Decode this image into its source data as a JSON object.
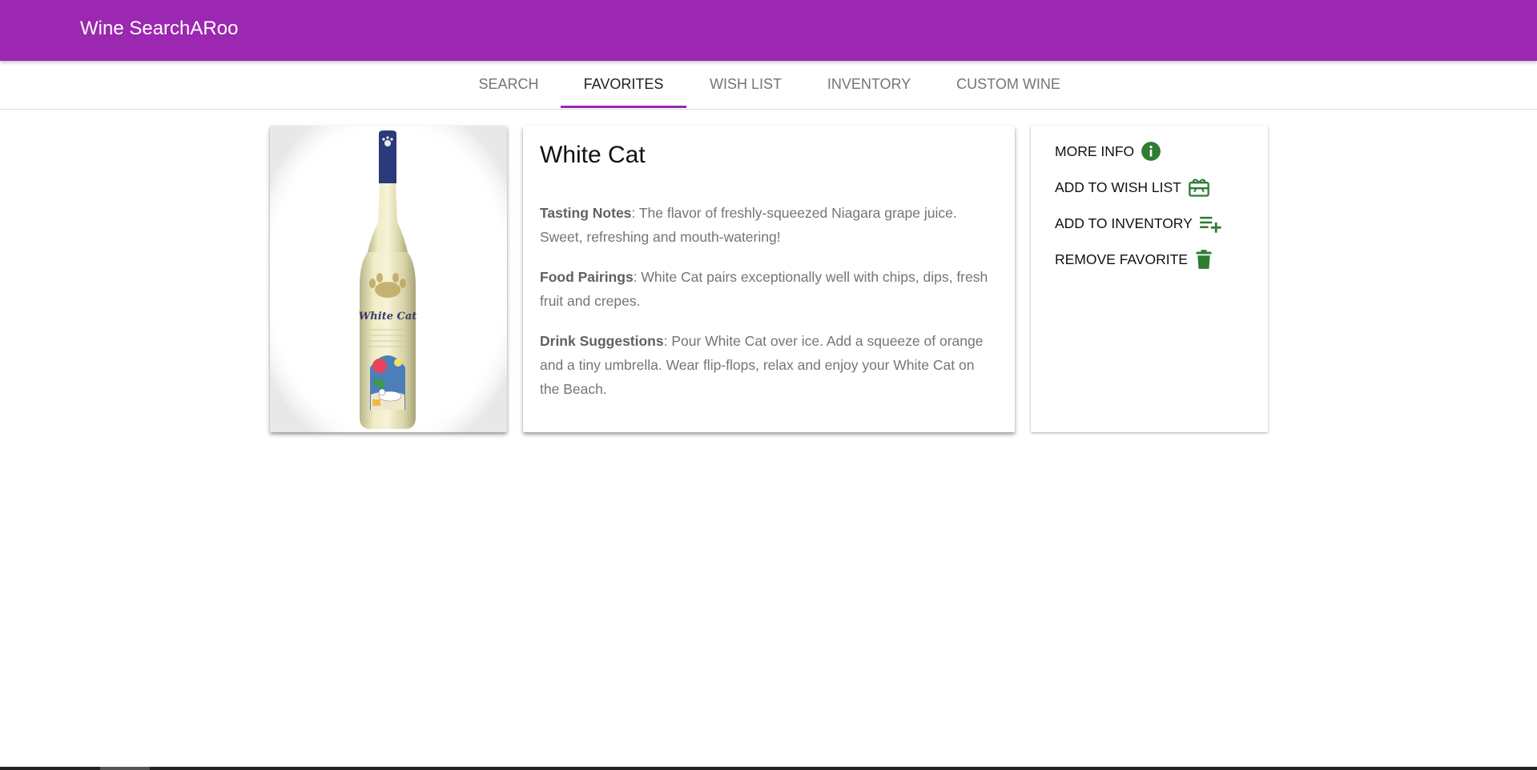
{
  "app": {
    "title": "Wine SearchARoo"
  },
  "tabs": [
    {
      "label": "Search",
      "active": false
    },
    {
      "label": "Favorites",
      "active": true
    },
    {
      "label": "Wish List",
      "active": false
    },
    {
      "label": "Inventory",
      "active": false
    },
    {
      "label": "Custom Wine",
      "active": false
    }
  ],
  "wine": {
    "name": "White Cat",
    "bottle_label": "White Cat",
    "tasting_notes": {
      "heading": "Tasting Notes",
      "text": ": The flavor of freshly-squeezed Niagara grape juice. Sweet, refreshing and mouth-watering!"
    },
    "food_pairings": {
      "heading": "Food Pairings",
      "text": ": White Cat pairs exceptionally well with chips, dips, fresh fruit and crepes."
    },
    "drink_suggestions": {
      "heading": "Drink Suggestions",
      "text": ": Pour White Cat over ice. Add a squeeze of orange and a tiny umbrella. Wear flip-flops, relax and enjoy your White Cat on the Beach."
    }
  },
  "actions": {
    "more_info": {
      "label": "More Info",
      "icon": "info-icon"
    },
    "add_wish_list": {
      "label": "Add to Wish List",
      "icon": "gift-card-icon"
    },
    "add_inventory": {
      "label": "Add to Inventory",
      "icon": "playlist-add-icon"
    },
    "remove_favorite": {
      "label": "Remove Favorite",
      "icon": "trash-icon"
    }
  },
  "colors": {
    "appbar": "#9c27b0",
    "accent": "#9c27b0",
    "icon_green": "#2e7d32"
  }
}
